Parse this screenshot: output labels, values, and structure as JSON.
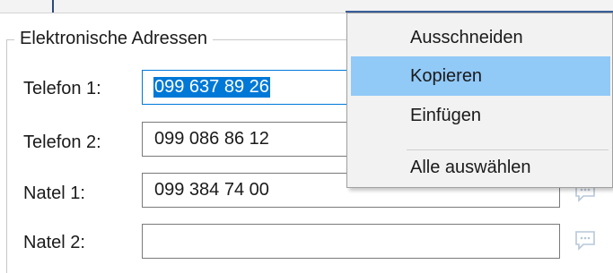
{
  "group": {
    "title": "Elektronische Adressen",
    "rows": [
      {
        "label": "Telefon 1:",
        "value": "099 637 89 26"
      },
      {
        "label": "Telefon 2:",
        "value": "099 086 86 12"
      },
      {
        "label": "Natel 1:",
        "value": "099 384 74 00"
      },
      {
        "label": "Natel 2:",
        "value": ""
      }
    ]
  },
  "context_menu": {
    "items": [
      {
        "label": "Ausschneiden"
      },
      {
        "label": "Kopieren"
      },
      {
        "label": "Einfügen"
      },
      {
        "label": "Alle auswählen"
      }
    ]
  },
  "icons": {
    "field_action": "chat-bubble-icon"
  },
  "colors": {
    "selection": "#0078d7",
    "menu_hover": "#91c9f7",
    "menu_bg": "#f2f2f2"
  }
}
